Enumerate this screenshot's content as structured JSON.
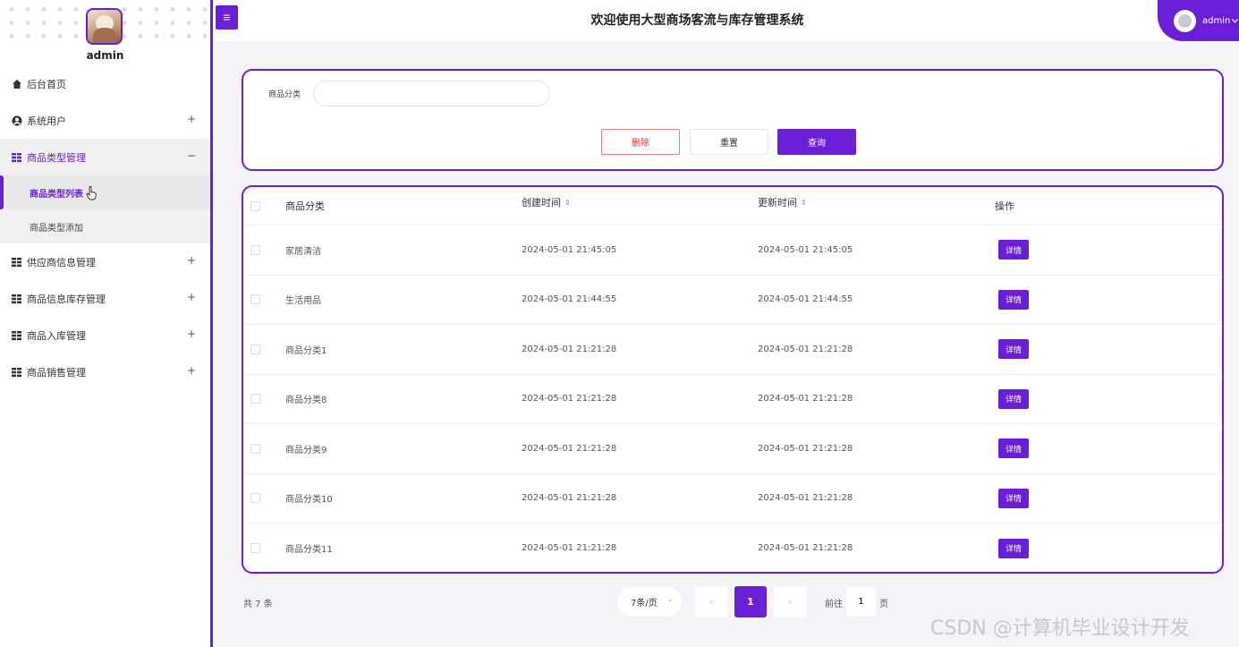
{
  "app": {
    "title": "欢迎使用大型商场客流与库存管理系统",
    "accent_color": "#6a1fd6"
  },
  "sidebar": {
    "username": "admin",
    "menu": [
      {
        "label": "后台首页",
        "icon": "home-icon"
      },
      {
        "label": "系统用户",
        "icon": "user-circle-icon",
        "expand": "+"
      },
      {
        "label": "商品类型管理",
        "icon": "grid-icon",
        "expand": "−",
        "children": [
          {
            "label": "商品类型列表",
            "active": true
          },
          {
            "label": "商品类型添加"
          }
        ]
      },
      {
        "label": "供应商信息管理",
        "icon": "grid-icon",
        "expand": "+"
      },
      {
        "label": "商品信息库存管理",
        "icon": "grid-icon",
        "expand": "+"
      },
      {
        "label": "商品入库管理",
        "icon": "grid-icon",
        "expand": "+"
      },
      {
        "label": "商品销售管理",
        "icon": "grid-icon",
        "expand": "+"
      }
    ]
  },
  "header": {
    "toggle_icon": "≡",
    "user_name": "admin"
  },
  "search": {
    "label": "商品分类",
    "value": "",
    "delete_label": "删除",
    "reset_label": "重置",
    "query_label": "查询"
  },
  "table": {
    "columns": [
      "商品分类",
      "创建时间",
      "更新时间",
      "操作"
    ],
    "action_label": "详情",
    "rows": [
      {
        "name": "家居清洁",
        "created": "2024-05-01 21:45:05",
        "updated": "2024-05-01 21:45:05"
      },
      {
        "name": "生活用品",
        "created": "2024-05-01 21:44:55",
        "updated": "2024-05-01 21:44:55"
      },
      {
        "name": "商品分类1",
        "created": "2024-05-01 21:21:28",
        "updated": "2024-05-01 21:21:28"
      },
      {
        "name": "商品分类8",
        "created": "2024-05-01 21:21:28",
        "updated": "2024-05-01 21:21:28"
      },
      {
        "name": "商品分类9",
        "created": "2024-05-01 21:21:28",
        "updated": "2024-05-01 21:21:28"
      },
      {
        "name": "商品分类10",
        "created": "2024-05-01 21:21:28",
        "updated": "2024-05-01 21:21:28"
      },
      {
        "name": "商品分类11",
        "created": "2024-05-01 21:21:28",
        "updated": "2024-05-01 21:21:28"
      }
    ]
  },
  "pagination": {
    "total": "共 7 条",
    "page_size": "7条/页",
    "prev": "‹",
    "current": "1",
    "next": "›",
    "goto_label": "前往",
    "goto_value": "1",
    "goto_suffix": "页"
  },
  "watermark": "CSDN @计算机毕业设计开发"
}
